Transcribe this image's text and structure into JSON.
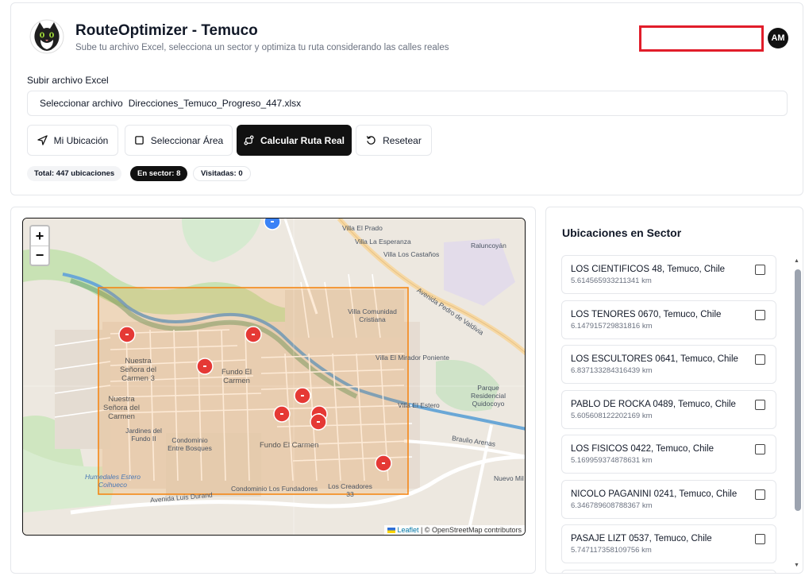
{
  "header": {
    "title": "RouteOptimizer - Temuco",
    "subtitle": "Sube tu archivo Excel, selecciona un sector y optimiza tu ruta considerando las calles reales",
    "avatar_initials": "AM",
    "logo_icon": "cat-logo-icon"
  },
  "upload": {
    "label": "Subir archivo Excel",
    "button_label": "Seleccionar archivo",
    "file_name": "Direcciones_Temuco_Progreso_447.xlsx"
  },
  "toolbar": {
    "my_location": "Mi Ubicación",
    "select_area": "Seleccionar Área",
    "calculate_route": "Calcular Ruta Real",
    "reset": "Resetear"
  },
  "badges": {
    "total": "Total: 447 ubicaciones",
    "in_sector": "En sector: 8",
    "visited": "Visitadas: 0"
  },
  "map": {
    "zoom_in": "+",
    "zoom_out": "−",
    "attribution_link": "Leaflet",
    "attribution_text": " | © OpenStreetMap contributors",
    "labels": {
      "villa_el_prado": "Villa El Prado",
      "villa_la_esperanza": "Villa La Esperanza",
      "villa_los_castanos": "Villa Los Castaños",
      "raluncoyan": "Raluncoyán",
      "av_pedro_de_valdivia": "Avenida Pedro de Valdivia",
      "villa_comunidad_cristiana": "Villa Comunidad Cristiana",
      "nuestra_senora_1": "Nuestra Señora del Carmen 3",
      "nuestra_senora_2": "Nuestra Señora del Carmen",
      "fundo_el_carmen_1": "Fundo El Carmen",
      "fundo_el_carmen_2": "Fundo El Carmen",
      "villa_el_mirador": "Villa El Mirador Poniente",
      "parque_residencial": "Parque Residencial Quidocoyo",
      "villa_el_estero": "Villa El Estero",
      "jardines_del_fundo": "Jardines del Fundo II",
      "condominio_entre_bosques": "Condominio Entre Bosques",
      "humedales": "Humedales Estero Coihueco",
      "condominio": "Condominio Los Fundadores",
      "los_creadores": "Los Creadores 33",
      "avenida_luis_durand": "Avenida Luis Durand",
      "brasilia_arenas": "Braulio Arenas",
      "nuevo_mil": "Nuevo Mil"
    }
  },
  "sidebar": {
    "title": "Ubicaciones en Sector",
    "items": [
      {
        "address": "LOS CIENTIFICOS 48, Temuco, Chile",
        "distance": "5.614565933211341 km"
      },
      {
        "address": "LOS TENORES 0670, Temuco, Chile",
        "distance": "6.147915729831816 km"
      },
      {
        "address": "LOS ESCULTORES 0641, Temuco, Chile",
        "distance": "6.837133284316439 km"
      },
      {
        "address": "PABLO DE ROCKA 0489, Temuco, Chile",
        "distance": "5.605608122202169 km"
      },
      {
        "address": "LOS FISICOS 0422, Temuco, Chile",
        "distance": "5.169959374878631 km"
      },
      {
        "address": "NICOLO PAGANINI 0241, Temuco, Chile",
        "distance": "6.346789608788367 km"
      },
      {
        "address": "PASAJE LIZT 0537, Temuco, Chile",
        "distance": "5.747117358109756 km"
      }
    ]
  },
  "colors": {
    "accent": "#111111",
    "marker": "#e53935",
    "selection": "#f5820b",
    "highlight_box": "#e11d2a"
  }
}
